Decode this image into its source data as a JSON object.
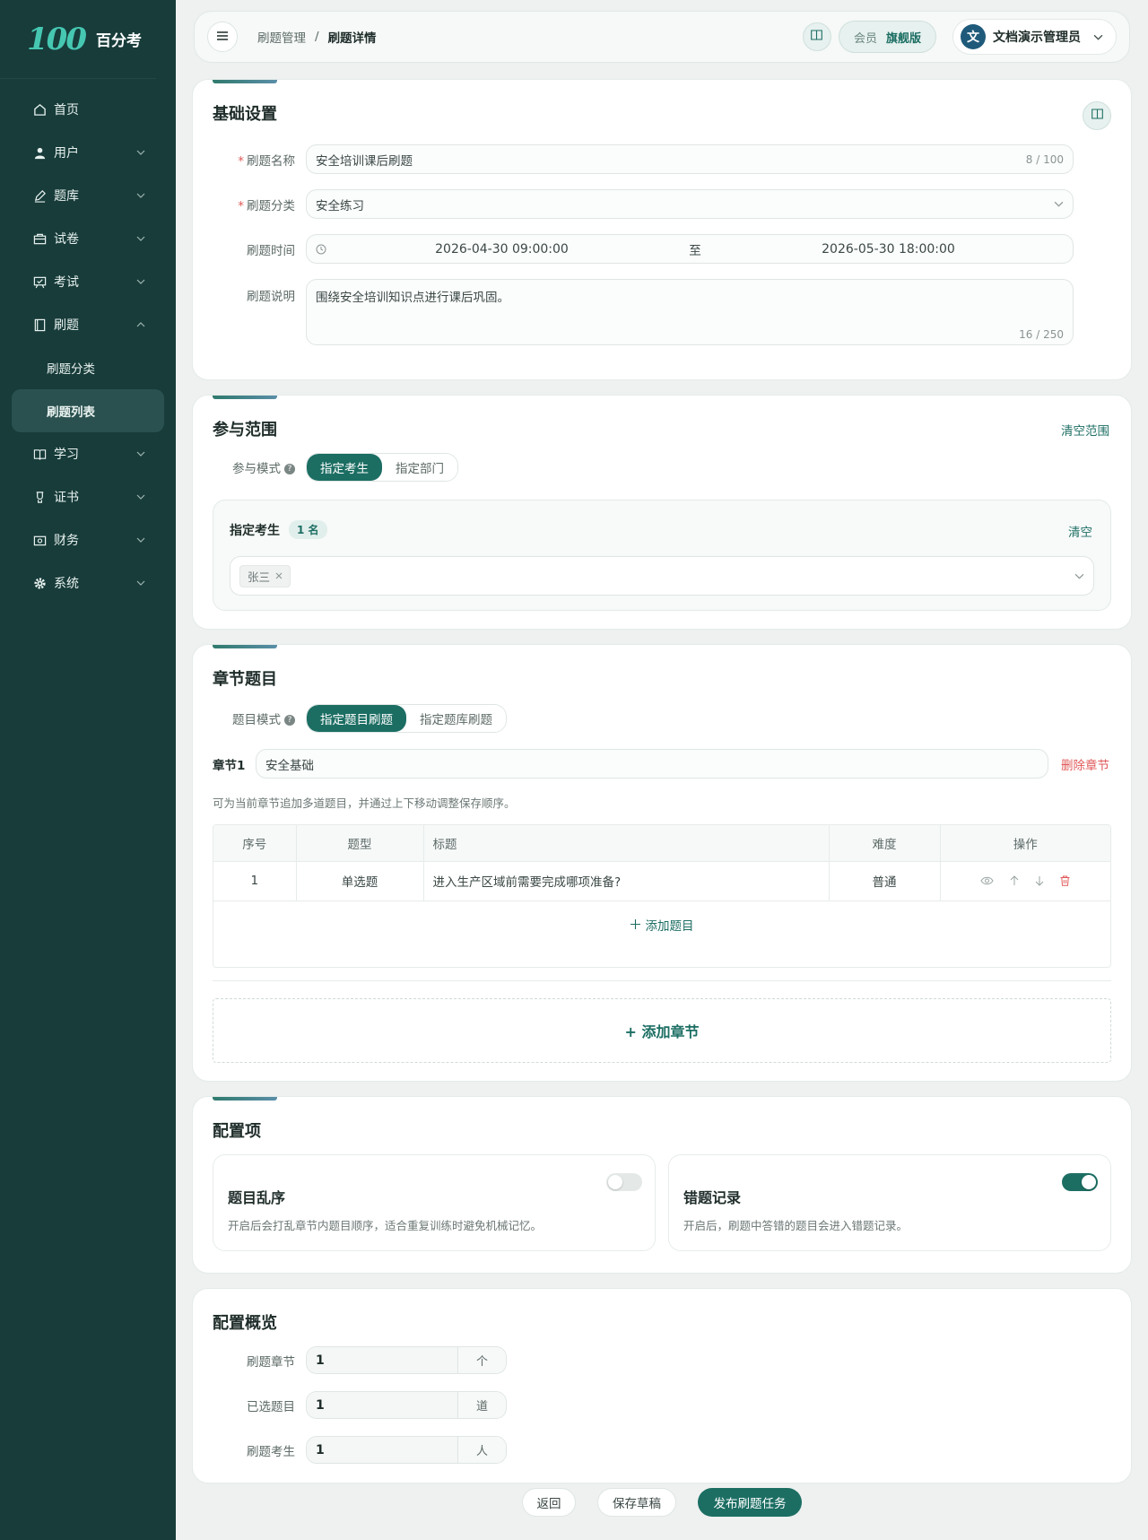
{
  "app": {
    "logo_mark": "100",
    "name": "百分考"
  },
  "sidebar": {
    "items": [
      {
        "label": "首页",
        "icon": "home-icon"
      },
      {
        "label": "用户",
        "icon": "user-icon"
      },
      {
        "label": "题库",
        "icon": "pen-icon"
      },
      {
        "label": "试卷",
        "icon": "briefcase-icon"
      },
      {
        "label": "考试",
        "icon": "exam-board-icon"
      },
      {
        "label": "刷题",
        "icon": "book-icon"
      },
      {
        "label": "学习",
        "icon": "open-book-icon"
      },
      {
        "label": "证书",
        "icon": "certificate-icon"
      },
      {
        "label": "财务",
        "icon": "finance-icon"
      },
      {
        "label": "系统",
        "icon": "gear-icon"
      }
    ],
    "sub_items": [
      {
        "label": "刷题分类"
      },
      {
        "label": "刷题列表"
      }
    ]
  },
  "header": {
    "breadcrumb": [
      "刷题管理",
      "/",
      "刷题详情"
    ],
    "vip_label": "会员",
    "vip_plan": "旗舰版",
    "avatar_char": "文",
    "username": "文档演示管理员"
  },
  "basic": {
    "title": "基础设置",
    "name_label": "刷题名称",
    "name_value": "安全培训课后刷题",
    "name_count": "8 / 100",
    "category_label": "刷题分类",
    "category_value": "安全练习",
    "time_label": "刷题时间",
    "time_start": "2026-04-30 09:00:00",
    "time_sep": "至",
    "time_end": "2026-05-30 18:00:00",
    "desc_label": "刷题说明",
    "desc_value": "围绕安全培训知识点进行课后巩固。",
    "desc_count": "16 / 250"
  },
  "scope": {
    "title": "参与范围",
    "clear_label": "清空范围",
    "mode_label": "参与模式",
    "mode_options": [
      "指定考生",
      "指定部门"
    ],
    "box_title": "指定考生",
    "box_count": "1 名",
    "box_clear": "清空",
    "tags": [
      "张三"
    ]
  },
  "chapters": {
    "title": "章节题目",
    "mode_label": "题目模式",
    "mode_options": [
      "指定题目刷题",
      "指定题库刷题"
    ],
    "chapter_label": "章节1",
    "chapter_name": "安全基础",
    "delete_label": "删除章节",
    "hint": "可为当前章节追加多道题目，并通过上下移动调整保存顺序。",
    "columns": [
      "序号",
      "题型",
      "标题",
      "难度",
      "操作"
    ],
    "rows": [
      {
        "no": "1",
        "type": "单选题",
        "title": "进入生产区域前需要完成哪项准备?",
        "level": "普通"
      }
    ],
    "add_question": "添加题目",
    "add_chapter": "+ 添加章节"
  },
  "config": {
    "title": "配置项",
    "shuffle_title": "题目乱序",
    "shuffle_desc": "开启后会打乱章节内题目顺序，适合重复训练时避免机械记忆。",
    "shuffle_on": false,
    "wrong_title": "错题记录",
    "wrong_desc": "开启后，刷题中答错的题目会进入错题记录。",
    "wrong_on": true
  },
  "overview": {
    "title": "配置概览",
    "stats": [
      {
        "label": "刷题章节",
        "value": "1",
        "unit": "个"
      },
      {
        "label": "已选题目",
        "value": "1",
        "unit": "道"
      },
      {
        "label": "刷题考生",
        "value": "1",
        "unit": "人"
      }
    ]
  },
  "footer": {
    "back": "返回",
    "draft": "保存草稿",
    "publish": "发布刷题任务"
  },
  "colors": {
    "sidebar_bg": "#173c3a",
    "accent": "#1c6e63",
    "danger": "#e05a5a"
  }
}
